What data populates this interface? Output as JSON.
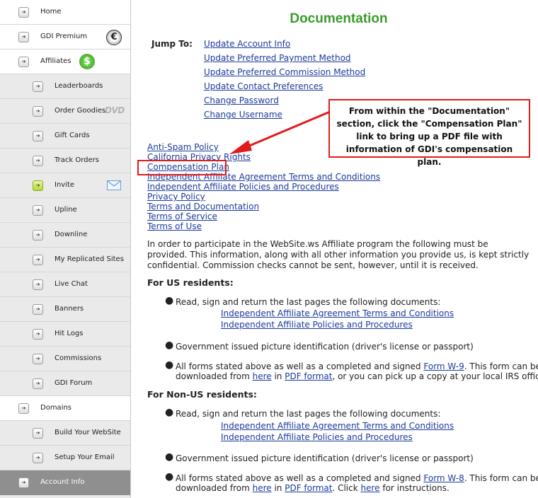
{
  "sidebar": {
    "items": [
      {
        "label": "Home",
        "level": "top",
        "icon": "arrow-right-icon",
        "extra": ""
      },
      {
        "label": "GDI Premium",
        "level": "top",
        "icon": "arrow-right-icon",
        "extra": "gdi-coin-icon"
      },
      {
        "label": "Affiliates",
        "level": "top",
        "icon": "arrow-right-icon",
        "extra": "dollar-icon"
      },
      {
        "label": "Leaderboards",
        "level": "sub",
        "icon": "arrow-right-icon",
        "extra": ""
      },
      {
        "label": "Order Goodies",
        "level": "sub",
        "icon": "arrow-right-icon",
        "extra": "dvd-icon"
      },
      {
        "label": "Gift Cards",
        "level": "sub",
        "icon": "arrow-right-icon",
        "extra": ""
      },
      {
        "label": "Track Orders",
        "level": "sub",
        "icon": "arrow-right-icon",
        "extra": ""
      },
      {
        "label": "Invite",
        "level": "sub",
        "icon": "arrow-right-icon",
        "extra": "mail-icon"
      },
      {
        "label": "Upline",
        "level": "sub",
        "icon": "arrow-right-icon",
        "extra": ""
      },
      {
        "label": "Downline",
        "level": "sub",
        "icon": "arrow-right-icon",
        "extra": ""
      },
      {
        "label": "My Replicated Sites",
        "level": "sub",
        "icon": "arrow-right-icon",
        "extra": ""
      },
      {
        "label": "Live Chat",
        "level": "sub",
        "icon": "arrow-right-icon",
        "extra": ""
      },
      {
        "label": "Banners",
        "level": "sub",
        "icon": "arrow-right-icon",
        "extra": ""
      },
      {
        "label": "Hit Logs",
        "level": "sub",
        "icon": "arrow-right-icon",
        "extra": ""
      },
      {
        "label": "Commissions",
        "level": "sub",
        "icon": "arrow-right-icon",
        "extra": ""
      },
      {
        "label": "GDI Forum",
        "level": "sub",
        "icon": "arrow-right-icon",
        "extra": ""
      },
      {
        "label": "Domains",
        "level": "top",
        "icon": "arrow-right-icon",
        "extra": ""
      },
      {
        "label": "Build Your WebSite",
        "level": "sub",
        "icon": "arrow-right-icon",
        "extra": ""
      },
      {
        "label": "Setup Your Email",
        "level": "sub",
        "icon": "arrow-right-icon",
        "extra": ""
      },
      {
        "label": "Account Info",
        "level": "top",
        "icon": "arrow-right-icon",
        "extra": "",
        "active": true
      }
    ],
    "arrow_glyph": "➔",
    "gdi_glyph": "€",
    "dollar_glyph": "$",
    "dvd_text": "DVD"
  },
  "main": {
    "title": "Documentation",
    "jump_label": "Jump To:",
    "jump_links": [
      "Update Account Info",
      "Update Preferred Payment Method",
      "Update Preferred Commission Method",
      "Update Contact Preferences",
      "Change Password",
      "Change Username"
    ],
    "policy_links": [
      "Anti-Spam Policy",
      "California Privacy Rights",
      "Compensation Plan",
      "Independent Affiliate Agreement Terms and Conditions",
      "Independent Affiliate Policies and Procedures",
      "Privacy Policy",
      "Terms and Documentation",
      "Terms of Service",
      "Terms of Use"
    ],
    "intro": "In order to participate in the WebSite.ws Affiliate program the following must be provided. This information, along with all other information you provide us, is kept strictly confidential. Commission checks cannot be sent, however, until it is received.",
    "us": {
      "heading": "For US residents:",
      "b1": "Read, sign and return the last pages the following documents:",
      "b1_link1": "Independent Affiliate Agreement Terms and Conditions",
      "b1_link2": "Independent Affiliate Policies and Procedures",
      "b2": "Government issued picture identification (driver's license or passport)",
      "b3_a": "All forms stated above as well as a completed and signed ",
      "b3_form": "Form W-9",
      "b3_b": ". This form can be",
      "b3_c": "downloaded from ",
      "b3_here": "here",
      "b3_in": " in ",
      "b3_pdf": "PDF format",
      "b3_d": ", or you can pick up a copy at your local IRS office."
    },
    "nonus": {
      "heading": "For Non-US residents:",
      "b1": "Read, sign and return the last pages the following documents:",
      "b1_link1": "Independent Affiliate Agreement Terms and Conditions",
      "b1_link2": "Independent Affiliate Policies and Procedures",
      "b2": "Government issued picture identification (driver's license or passport)",
      "b3_a": "All forms stated above as well as a completed and signed ",
      "b3_form": "Form W-8",
      "b3_b": ". This form can be",
      "b3_c": "downloaded from ",
      "b3_here": "here",
      "b3_in": " in ",
      "b3_pdf": "PDF format",
      "b3_d": ". Click ",
      "b3_here2": "here",
      "b3_e": " for instructions."
    },
    "bullet_glyph": "●"
  },
  "callout": {
    "line1": "From within the \"Documentation\"",
    "line2": "section, click the \"Compensation Plan\"",
    "line3": "link to bring up a PDF file with",
    "line4": "information of GDI's compensation plan."
  },
  "colors": {
    "title_green": "#3b9b2c",
    "link_blue": "#1b3a9c",
    "annotation_red": "#e11b1b"
  }
}
